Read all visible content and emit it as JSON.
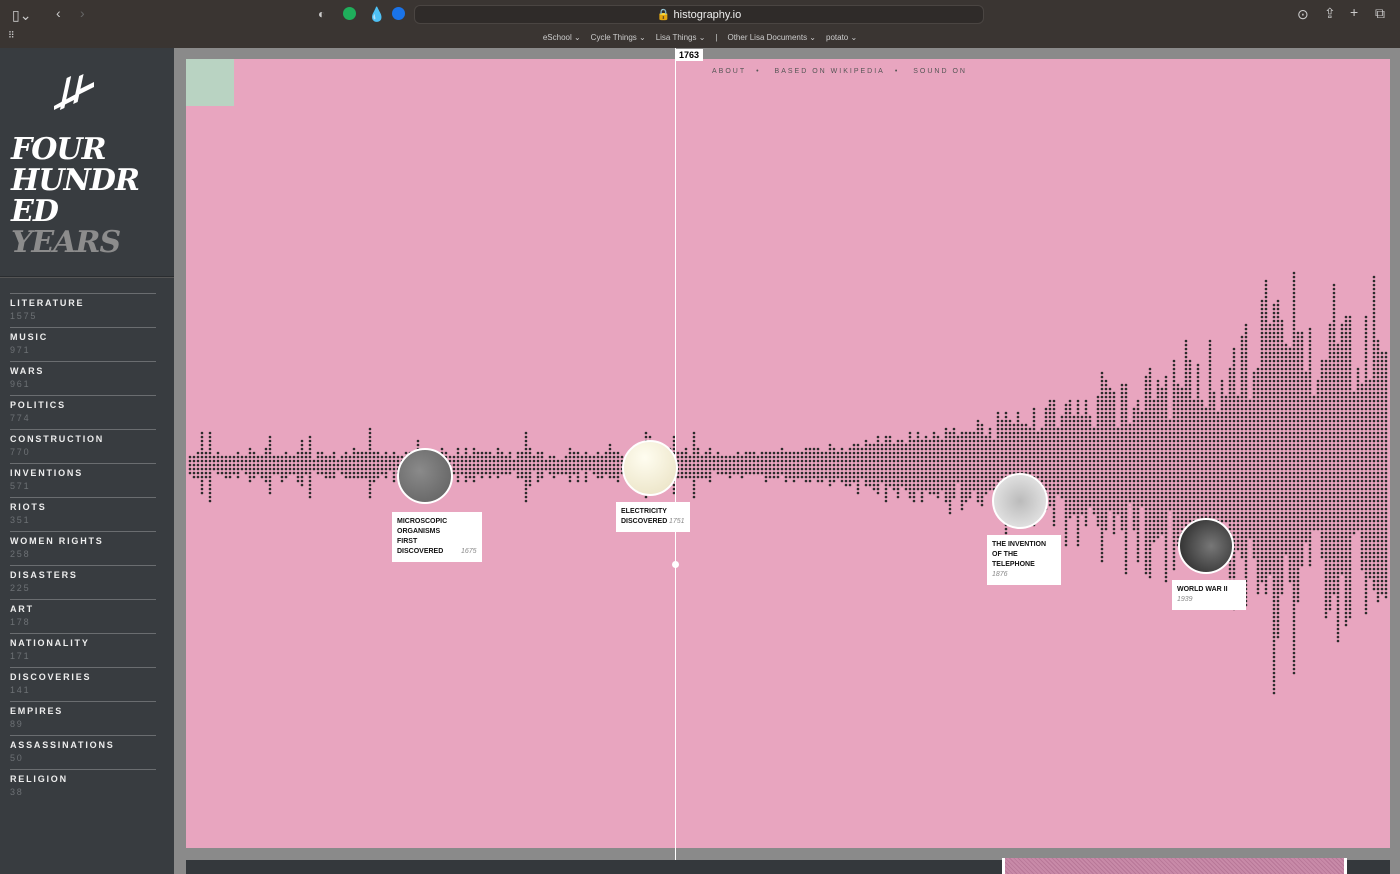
{
  "browser": {
    "url": "histography.io",
    "bookmarks": [
      "eSchool ⌄",
      "Cycle Things ⌄",
      "Lisa Things ⌄",
      "|",
      "Other Lisa Documents ⌄",
      "potato ⌄"
    ]
  },
  "sidebar": {
    "title_lines": [
      "FOUR",
      "HUNDR",
      "ED"
    ],
    "title_gray": "YEARS",
    "categories": [
      {
        "name": "LITERATURE",
        "count": "1575"
      },
      {
        "name": "MUSIC",
        "count": "971"
      },
      {
        "name": "WARS",
        "count": "961"
      },
      {
        "name": "POLITICS",
        "count": "774"
      },
      {
        "name": "CONSTRUCTION",
        "count": "770"
      },
      {
        "name": "INVENTIONS",
        "count": "571"
      },
      {
        "name": "RIOTS",
        "count": "351"
      },
      {
        "name": "WOMEN RIGHTS",
        "count": "258"
      },
      {
        "name": "DISASTERS",
        "count": "225"
      },
      {
        "name": "ART",
        "count": "178"
      },
      {
        "name": "NATIONALITY",
        "count": "171"
      },
      {
        "name": "DISCOVERIES",
        "count": "141"
      },
      {
        "name": "EMPIRES",
        "count": "89"
      },
      {
        "name": "ASSASSINATIONS",
        "count": "50"
      },
      {
        "name": "RELIGION",
        "count": "38"
      }
    ]
  },
  "nav": {
    "about": "ABOUT",
    "based": "BASED ON WIKIPEDIA",
    "sound": "SOUND ON",
    "sep": "•"
  },
  "cursor_year": "1763",
  "events": [
    {
      "title": "MICROSCOPIC ORGANISMS FIRST DISCOVERED",
      "year": "1675",
      "image": "microscope-photo"
    },
    {
      "title": "ELECTRICITY DISCOVERED",
      "year": "1751",
      "image": "electricity-photo"
    },
    {
      "title": "THE INVENTION OF THE TELEPHONE",
      "year": "1876",
      "image": "telephone-photo"
    },
    {
      "title": "WORLD WAR II",
      "year": "1939",
      "image": "ww2-photo"
    }
  ],
  "colors": {
    "canvas": "#e8a5bf",
    "sidebar": "#383c40",
    "dot": "#2a2a2a",
    "accent_green": "#b9d3c2"
  }
}
